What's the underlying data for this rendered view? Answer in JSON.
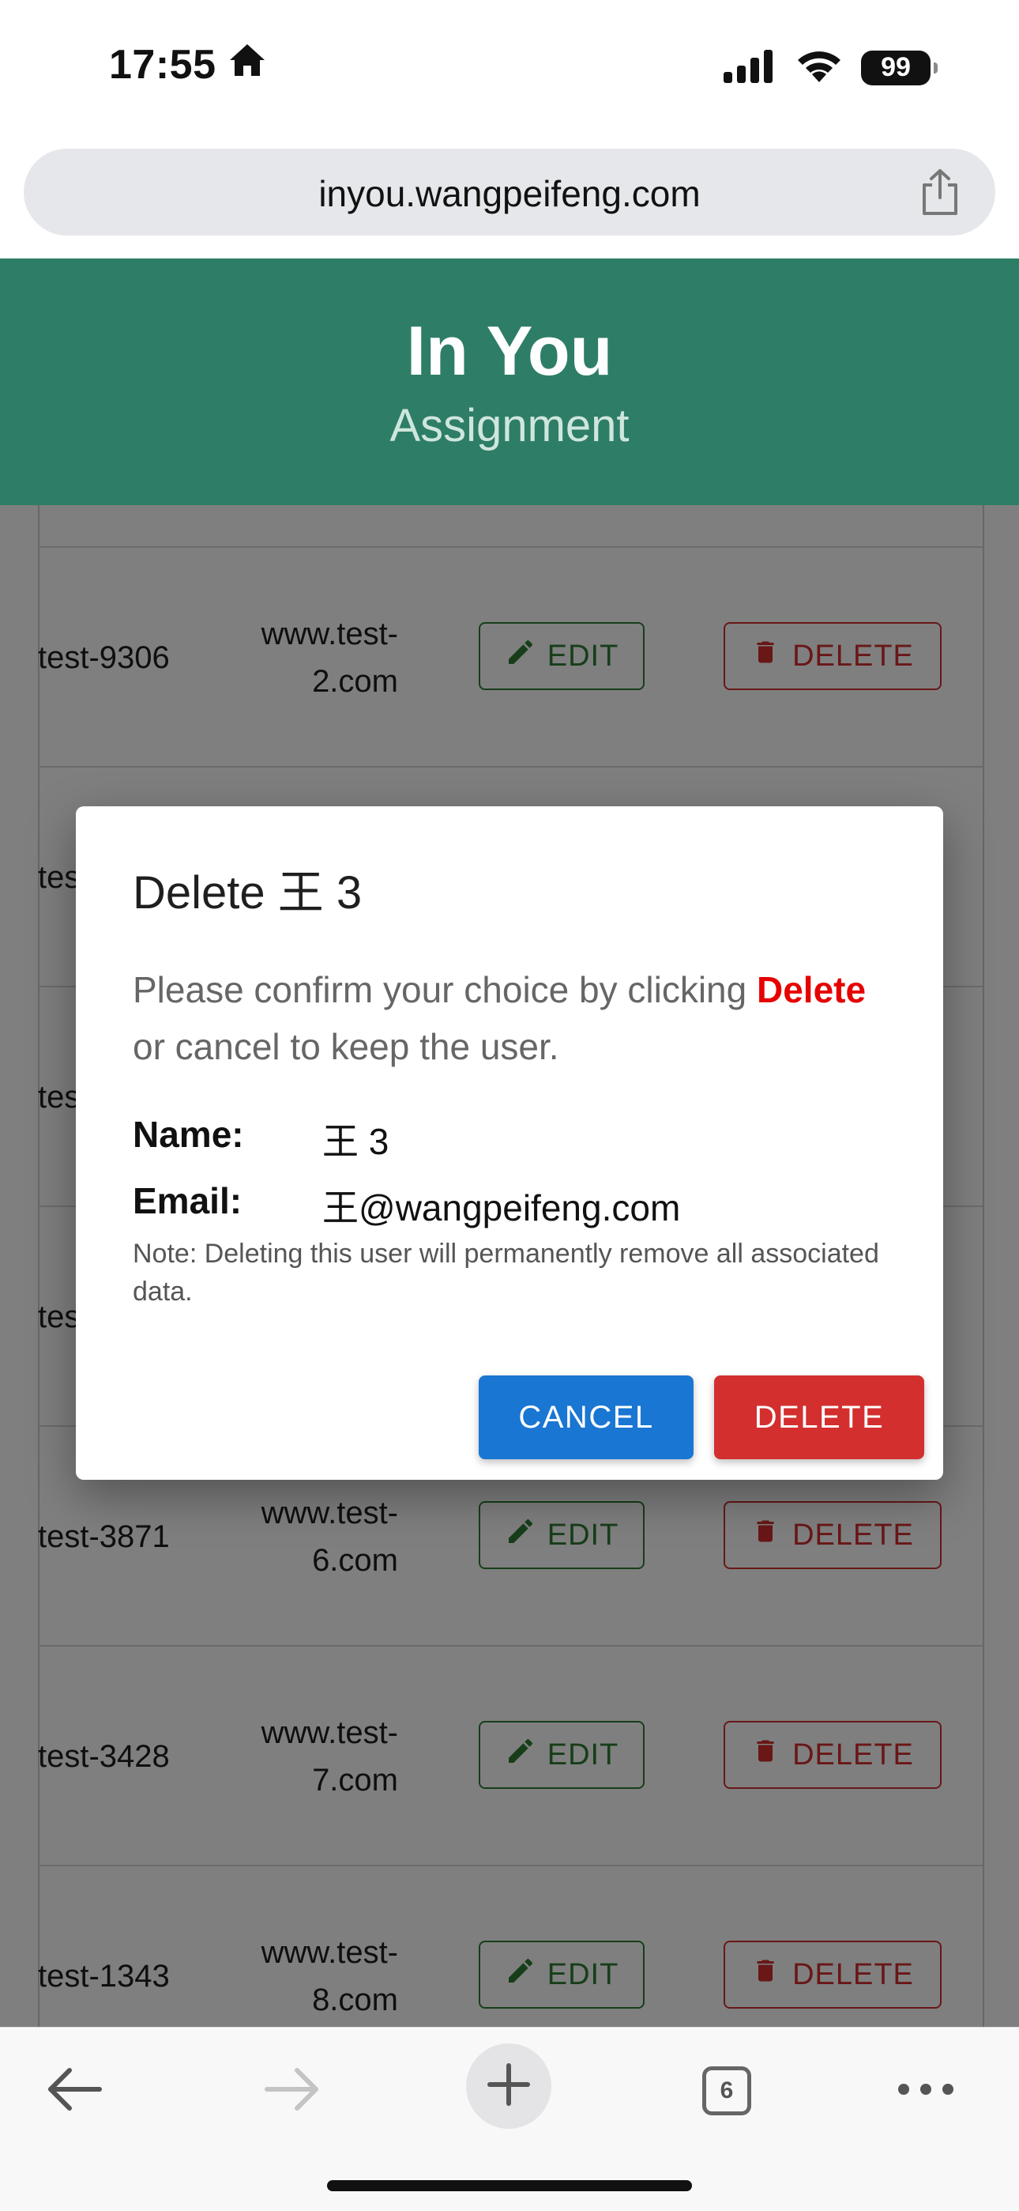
{
  "status_bar": {
    "time": "17:55",
    "battery": "99"
  },
  "browser": {
    "url": "inyou.wangpeifeng.com",
    "tab_count": "6"
  },
  "header": {
    "title": "In You",
    "subtitle": "Assignment"
  },
  "list": {
    "edit_label": "EDIT",
    "delete_label": "DELETE",
    "rows": [
      {
        "name": "test-9306",
        "website": "www.test-\n2.com",
        "show_buttons": true
      },
      {
        "name": "tes",
        "website": "",
        "show_buttons": false
      },
      {
        "name": "tes",
        "website": "",
        "show_buttons": false
      },
      {
        "name": "tes",
        "website": "",
        "show_buttons": false
      },
      {
        "name": "test-3871",
        "website": "www.test-\n6.com",
        "show_buttons": true
      },
      {
        "name": "test-3428",
        "website": "www.test-\n7.com",
        "show_buttons": true
      },
      {
        "name": "test-1343",
        "website": "www.test-\n8.com",
        "show_buttons": true
      }
    ]
  },
  "dialog": {
    "title": "Delete 王 3",
    "message_before": "Please confirm your choice by clicking ",
    "message_emphasis": "Delete",
    "message_after": " or cancel to keep the user.",
    "name_label": "Name:",
    "name_value": "王 3",
    "email_label": "Email:",
    "email_value": "王@wangpeifeng.com",
    "note": "Note: Deleting this user will permanently remove all associated data.",
    "cancel_label": "CANCEL",
    "confirm_label": "DELETE"
  },
  "colors": {
    "header_bg": "#2e7d67",
    "edit": "#2e7d32",
    "delete": "#d32f2f",
    "cancel": "#1976d2",
    "emphasis": "#e60000"
  }
}
